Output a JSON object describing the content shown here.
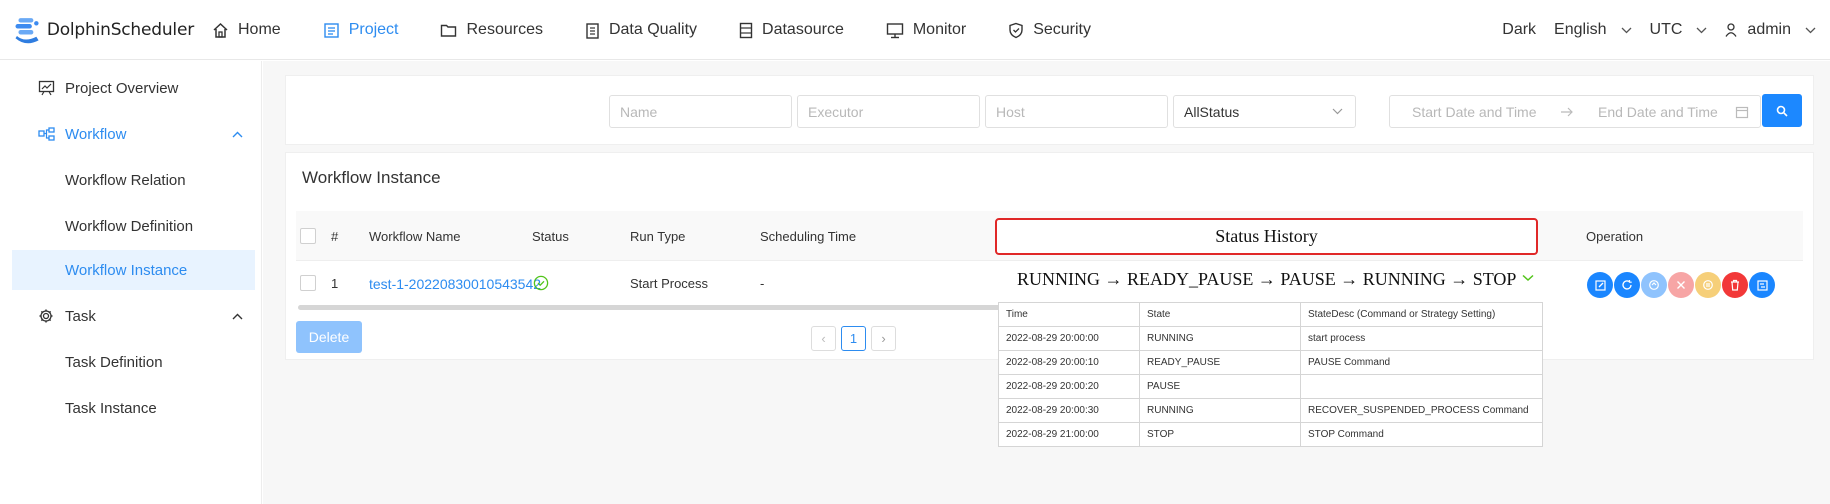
{
  "app": {
    "name": "DolphinScheduler"
  },
  "nav": [
    {
      "label": "Home",
      "icon": "home-icon",
      "active": false
    },
    {
      "label": "Project",
      "icon": "project-icon",
      "active": true
    },
    {
      "label": "Resources",
      "icon": "folder-icon",
      "active": false
    },
    {
      "label": "Data Quality",
      "icon": "clipboard-icon",
      "active": false
    },
    {
      "label": "Datasource",
      "icon": "database-icon",
      "active": false
    },
    {
      "label": "Monitor",
      "icon": "monitor-icon",
      "active": false
    },
    {
      "label": "Security",
      "icon": "shield-icon",
      "active": false
    }
  ],
  "topbar": {
    "theme": "Dark",
    "language": "English",
    "timezone": "UTC",
    "user": "admin"
  },
  "sidebar": {
    "project_overview": "Project Overview",
    "workflow": "Workflow",
    "workflow_relation": "Workflow Relation",
    "workflow_definition": "Workflow Definition",
    "workflow_instance": "Workflow Instance",
    "task": "Task",
    "task_definition": "Task Definition",
    "task_instance": "Task Instance"
  },
  "filters": {
    "name_placeholder": "Name",
    "executor_placeholder": "Executor",
    "host_placeholder": "Host",
    "status_value": "AllStatus",
    "start_date_placeholder": "Start Date and Time",
    "end_date_placeholder": "End Date and Time"
  },
  "workflow_instance": {
    "title": "Workflow Instance",
    "columns": {
      "index": "#",
      "name": "Workflow Name",
      "status": "Status",
      "run_type": "Run Type",
      "scheduling_time": "Scheduling Time",
      "operation": "Operation"
    },
    "rows": [
      {
        "index": "1",
        "name": "test-1-20220830010543542",
        "run_type": "Start Process",
        "scheduling_time": "-"
      }
    ],
    "delete_label": "Delete",
    "pagination": {
      "prev": "‹",
      "current": "1",
      "next": "›"
    }
  },
  "status_history": {
    "title": "Status History",
    "sequence": "RUNNING → READY_PAUSE → PAUSE → RUNNING → STOP",
    "headers": [
      "Time",
      "State",
      "StateDesc (Command or Strategy Setting)"
    ],
    "rows": [
      [
        "2022-08-29 20:00:00",
        "RUNNING",
        "start process"
      ],
      [
        "2022-08-29 20:00:10",
        "READY_PAUSE",
        "PAUSE Command"
      ],
      [
        "2022-08-29 20:00:20",
        "PAUSE",
        ""
      ],
      [
        "2022-08-29 20:00:30",
        "RUNNING",
        "RECOVER_SUSPENDED_PROCESS Command"
      ],
      [
        "2022-08-29 21:00:00",
        "STOP",
        "STOP Command"
      ]
    ]
  },
  "colors": {
    "primary": "#2d8cf0",
    "search_button": "#1c88ff",
    "status_ok": "#52c41a",
    "highlight_border": "#e02828"
  }
}
